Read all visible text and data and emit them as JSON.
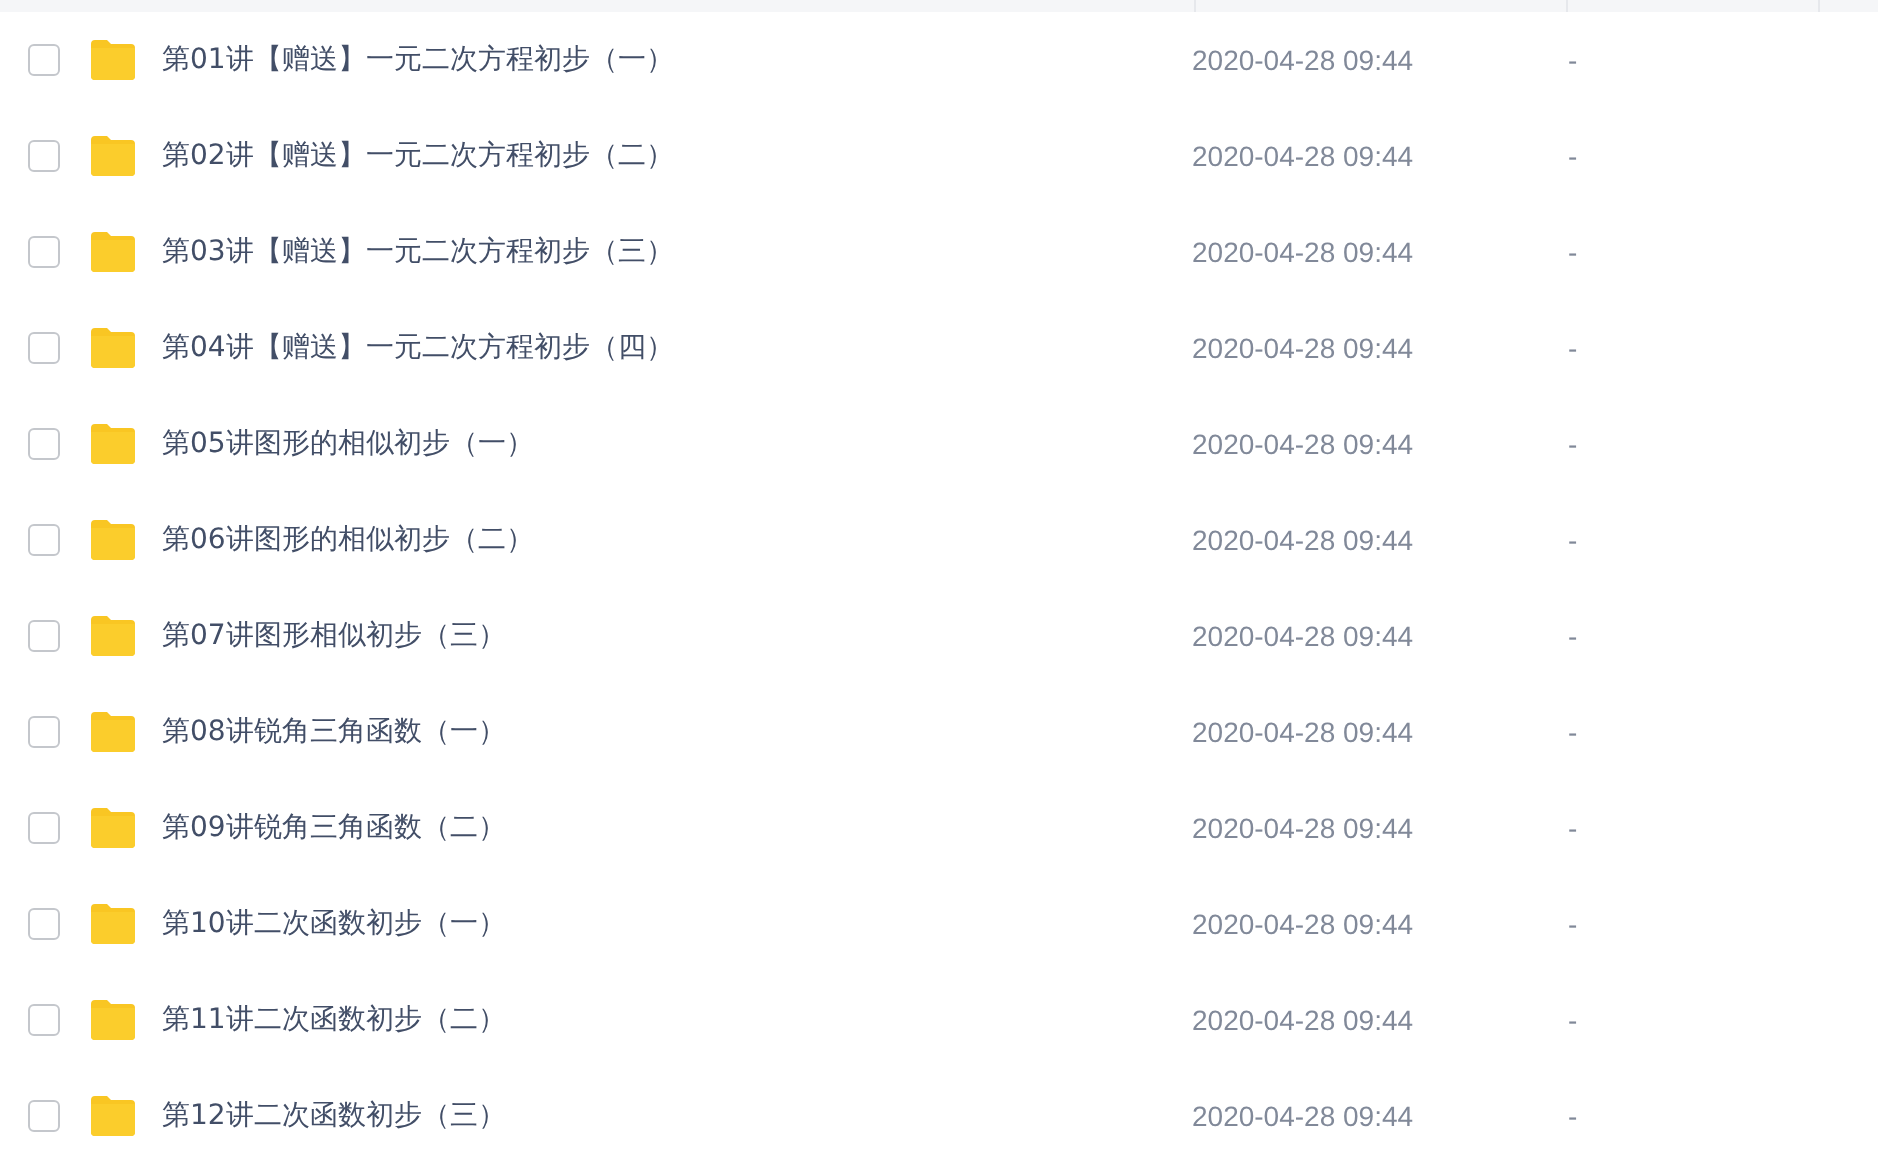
{
  "files": [
    {
      "name": "第01讲【赠送】一元二次方程初步（一）",
      "modified": "2020-04-28 09:44",
      "size": "-",
      "checked": false
    },
    {
      "name": "第02讲【赠送】一元二次方程初步（二）",
      "modified": "2020-04-28 09:44",
      "size": "-",
      "checked": false
    },
    {
      "name": "第03讲【赠送】一元二次方程初步（三）",
      "modified": "2020-04-28 09:44",
      "size": "-",
      "checked": false
    },
    {
      "name": "第04讲【赠送】一元二次方程初步（四）",
      "modified": "2020-04-28 09:44",
      "size": "-",
      "checked": false
    },
    {
      "name": "第05讲图形的相似初步（一）",
      "modified": "2020-04-28 09:44",
      "size": "-",
      "checked": false
    },
    {
      "name": "第06讲图形的相似初步（二）",
      "modified": "2020-04-28 09:44",
      "size": "-",
      "checked": false
    },
    {
      "name": "第07讲图形相似初步（三）",
      "modified": "2020-04-28 09:44",
      "size": "-",
      "checked": false
    },
    {
      "name": "第08讲锐角三角函数（一）",
      "modified": "2020-04-28 09:44",
      "size": "-",
      "checked": false
    },
    {
      "name": "第09讲锐角三角函数（二）",
      "modified": "2020-04-28 09:44",
      "size": "-",
      "checked": false
    },
    {
      "name": "第10讲二次函数初步（一）",
      "modified": "2020-04-28 09:44",
      "size": "-",
      "checked": false
    },
    {
      "name": "第11讲二次函数初步（二）",
      "modified": "2020-04-28 09:44",
      "size": "-",
      "checked": false
    },
    {
      "name": "第12讲二次函数初步（三）",
      "modified": "2020-04-28 09:44",
      "size": "-",
      "checked": false
    }
  ]
}
